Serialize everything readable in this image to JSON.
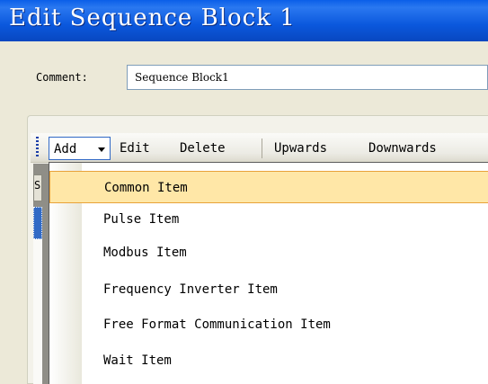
{
  "window": {
    "title": "Edit Sequence Block 1"
  },
  "comment": {
    "label": "Comment:",
    "value": "Sequence Block1"
  },
  "toolbar": {
    "add_label": "Add",
    "edit_label": "Edit",
    "delete_label": "Delete",
    "upwards_label": "Upwards",
    "downwards_label": "Downwards"
  },
  "grid": {
    "header_fragment": "S"
  },
  "add_menu": {
    "items": [
      {
        "label": "Common Item",
        "highlighted": true
      },
      {
        "label": "Pulse Item"
      },
      {
        "label": "Modbus Item"
      },
      {
        "label": "Frequency Inverter Item"
      },
      {
        "label": "Free Format Communication Item"
      },
      {
        "label": "Wait Item"
      }
    ]
  },
  "colors": {
    "titlebar": "#0b58dd",
    "menu_highlight": "#ffe7a7",
    "menu_highlight_border": "#e8a23a",
    "selection": "#316ac5"
  }
}
